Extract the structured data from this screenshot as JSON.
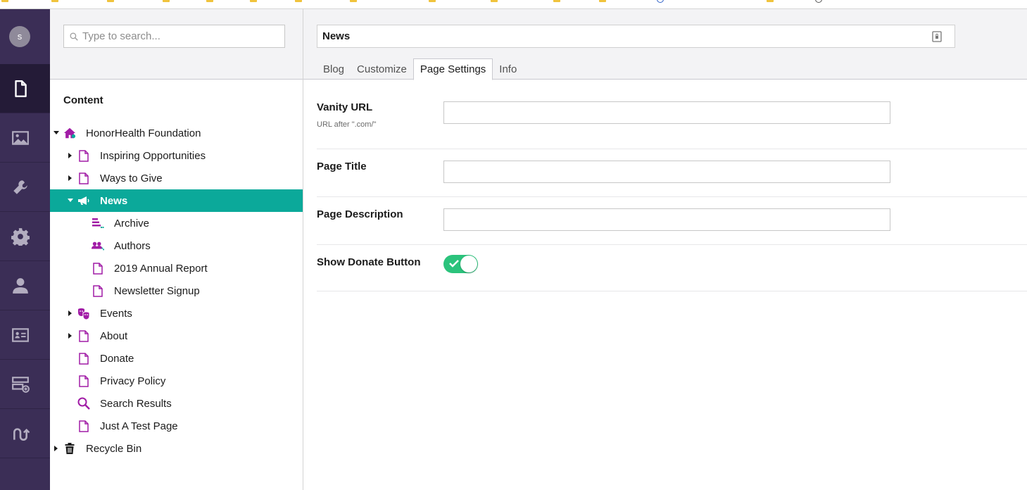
{
  "colors": {
    "appbar": "#3b2e56",
    "appbar_active": "#241b37",
    "selected_node": "#0ba99a",
    "doc_icon": "#a11ca6",
    "toggle_on": "#2bc37c"
  },
  "user": {
    "avatar_initial": "s"
  },
  "appbar_sections": [
    {
      "name": "content",
      "icon": "document-icon",
      "active": true
    },
    {
      "name": "media",
      "icon": "image-icon",
      "active": false
    },
    {
      "name": "settings",
      "icon": "wrench-icon",
      "active": false
    },
    {
      "name": "packages",
      "icon": "gear-icon",
      "active": false
    },
    {
      "name": "users",
      "icon": "user-icon",
      "active": false
    },
    {
      "name": "members",
      "icon": "id-card-icon",
      "active": false
    },
    {
      "name": "forms",
      "icon": "form-add-icon",
      "active": false
    },
    {
      "name": "redirects",
      "icon": "redirect-icon",
      "active": false
    }
  ],
  "search": {
    "placeholder": "Type to search..."
  },
  "tree": {
    "section_title": "Content",
    "nodes": [
      {
        "label": "HonorHealth Foundation",
        "depth": 0,
        "caret": "down",
        "icon": "home-icon",
        "selected": false
      },
      {
        "label": "Inspiring Opportunities",
        "depth": 1,
        "caret": "right",
        "icon": "document-icon",
        "selected": false
      },
      {
        "label": "Ways to Give",
        "depth": 1,
        "caret": "right",
        "icon": "document-icon",
        "selected": false
      },
      {
        "label": "News",
        "depth": 1,
        "caret": "down",
        "icon": "megaphone-icon",
        "selected": true
      },
      {
        "label": "Archive",
        "depth": 2,
        "caret": "",
        "icon": "list-icon",
        "selected": false
      },
      {
        "label": "Authors",
        "depth": 2,
        "caret": "",
        "icon": "users-icon",
        "selected": false
      },
      {
        "label": "2019 Annual Report",
        "depth": 2,
        "caret": "",
        "icon": "document-icon",
        "selected": false
      },
      {
        "label": "Newsletter Signup",
        "depth": 2,
        "caret": "",
        "icon": "document-icon",
        "selected": false
      },
      {
        "label": "Events",
        "depth": 1,
        "caret": "right",
        "icon": "theater-masks-icon",
        "selected": false
      },
      {
        "label": "About",
        "depth": 1,
        "caret": "right",
        "icon": "document-icon",
        "selected": false
      },
      {
        "label": "Donate",
        "depth": 1,
        "caret": "",
        "icon": "document-icon",
        "selected": false
      },
      {
        "label": "Privacy Policy",
        "depth": 1,
        "caret": "",
        "icon": "document-icon",
        "selected": false
      },
      {
        "label": "Search Results",
        "depth": 1,
        "caret": "",
        "icon": "magnifier-icon",
        "selected": false
      },
      {
        "label": "Just A Test Page",
        "depth": 1,
        "caret": "",
        "icon": "document-icon",
        "selected": false
      },
      {
        "label": "Recycle Bin",
        "depth": 0,
        "caret": "right",
        "icon": "trash-icon",
        "selected": false
      }
    ]
  },
  "editor": {
    "node_name": "News",
    "tabs": [
      {
        "label": "Blog",
        "active": false
      },
      {
        "label": "Customize",
        "active": false
      },
      {
        "label": "Page Settings",
        "active": true
      },
      {
        "label": "Info",
        "active": false
      }
    ],
    "properties": {
      "vanity_url": {
        "label": "Vanity URL",
        "description": "URL after \".com/\"",
        "value": ""
      },
      "page_title": {
        "label": "Page Title",
        "value": ""
      },
      "page_description": {
        "label": "Page Description",
        "value": ""
      },
      "show_donate_button": {
        "label": "Show Donate Button",
        "value": true
      }
    }
  }
}
